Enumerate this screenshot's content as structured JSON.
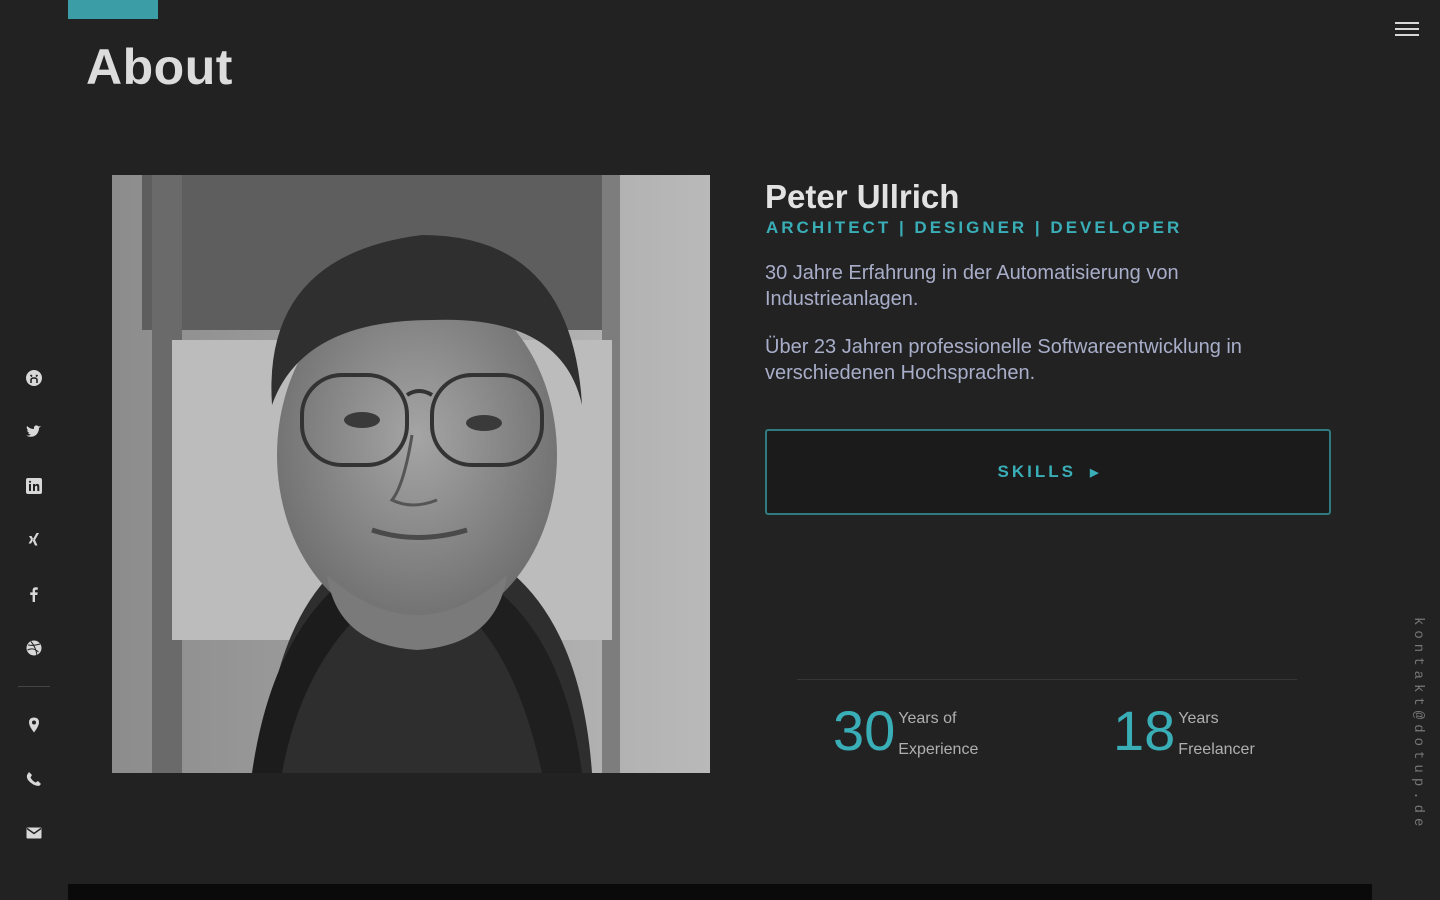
{
  "header": {
    "title": "About"
  },
  "profile": {
    "name": "Peter Ullrich",
    "roles": "ARCHITECT | DESIGNER | DEVELOPER",
    "bio": [
      "30 Jahre Erfahrung in der Automatisierung von Industrieanlagen.",
      "Über 23 Jahren professionelle Softwareentwicklung in verschiedenen Hochsprachen."
    ],
    "skills_button": "SKILLS"
  },
  "stats": [
    {
      "value": "30",
      "label_line1": "Years of",
      "label_line2": "Experience"
    },
    {
      "value": "18",
      "label_line1": "Years",
      "label_line2": "Freelancer"
    }
  ],
  "sidebar": {
    "icons": [
      "github-icon",
      "twitter-icon",
      "linkedin-icon",
      "xing-icon",
      "facebook-icon",
      "dribbble-icon",
      "location-icon",
      "phone-icon",
      "mail-icon"
    ]
  },
  "contact_email": "kontakt@dotup.de",
  "colors": {
    "accent": "#3aaeb7",
    "background": "#222223",
    "bio_text": "#a8aec9"
  }
}
